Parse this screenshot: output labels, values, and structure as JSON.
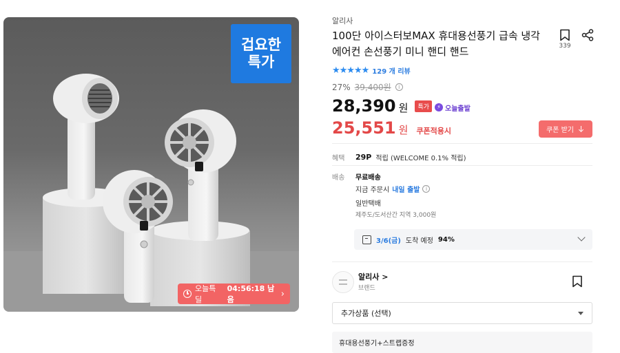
{
  "product_image": {
    "badge_line1": "겁요한",
    "badge_line2": "특가",
    "timer_label": "오늘특딜",
    "timer_value": "04:56:18 남음",
    "timer_arrow": "›",
    "timer_color": "#f26464",
    "badge_color": "#1f7ae0"
  },
  "seller_name": "알리사",
  "title": "100단 아이스터보MAX 휴대용선풍기 급속 냉각 에어컨 손선풍기 미니 핸디 핸드",
  "bookmark_count": "339",
  "rating": {
    "stars": 5,
    "star_glyphs": "★★★★★",
    "review_count": "129 개 리뷰"
  },
  "discount": {
    "rate": "27%",
    "original_price": "39,400원"
  },
  "price": {
    "value": "28,390",
    "unit": "원",
    "tag_special": "특가",
    "tag_today": "오늘출발"
  },
  "coupon": {
    "price": "25,551",
    "unit": "원",
    "label": "쿠폰적용시",
    "button_label": "쿠폰 받기",
    "accent": "#e34848"
  },
  "benefit": {
    "label": "혜택",
    "points": "29P",
    "desc": "적립 (WELCOME 0.1% 적립)"
  },
  "shipping": {
    "label": "배송",
    "free": "무료배송",
    "order_prefix": "지금 주문시",
    "order_highlight": "내일 출발",
    "type": "일반택배",
    "extra": "제주도/도서산간 지역 3,000원",
    "arrival_date": "3/6(금)",
    "arrival_text": "도착 예정",
    "arrival_pct": "94%"
  },
  "brand": {
    "name": "알리사 >",
    "sub": "브랜드"
  },
  "add_product_select": "추가상품 (선택)",
  "option_label": "휴대용선풍기+스트랩증정"
}
